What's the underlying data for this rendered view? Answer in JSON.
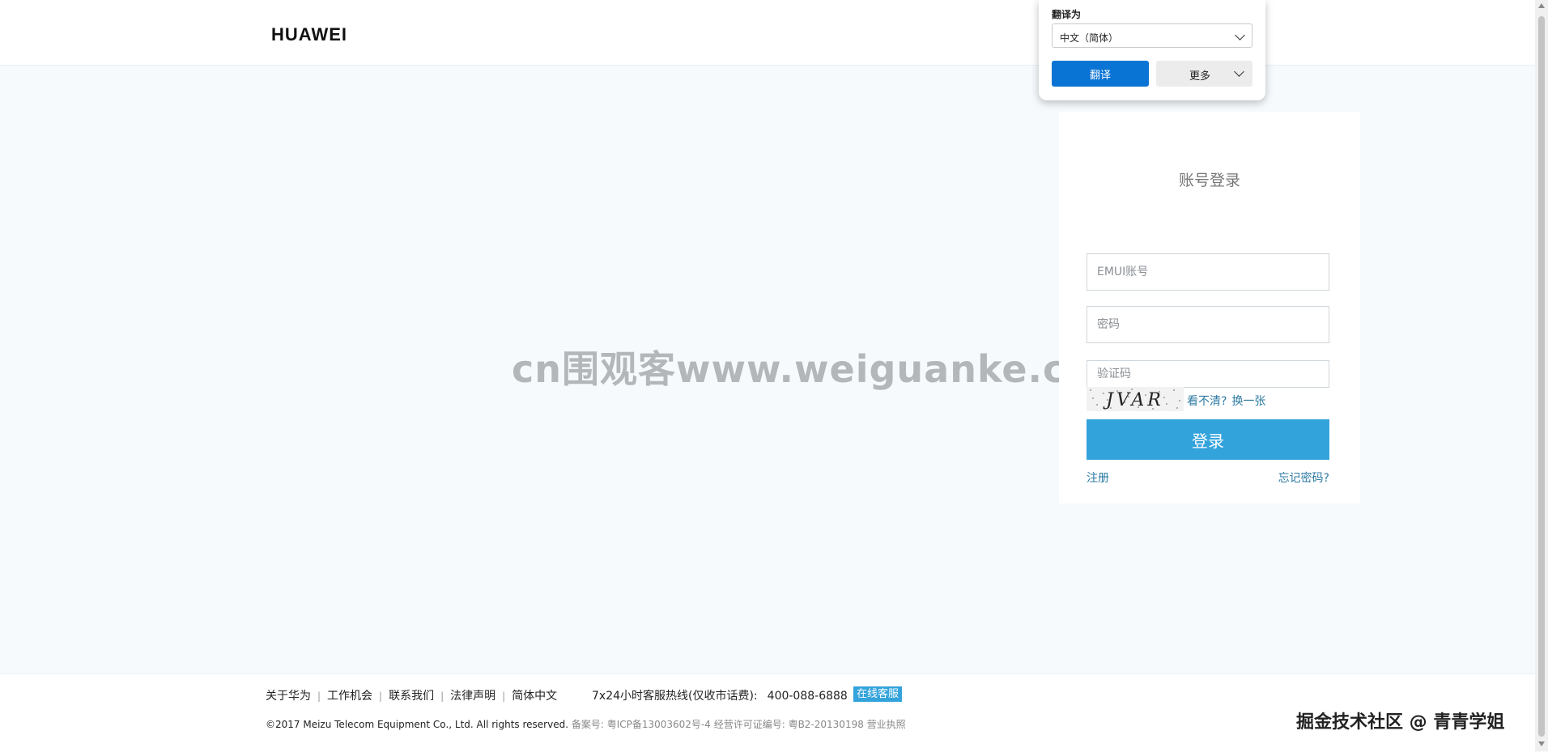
{
  "header": {
    "logo": "HUAWEI"
  },
  "watermark": "cn围观客www.weiguanke.cn",
  "translate_popup": {
    "label": "翻译为",
    "selected_language": "中文（简体）",
    "translate_button": "翻译",
    "more_button": "更多"
  },
  "login": {
    "title": "账号登录",
    "account_placeholder": "EMUI账号",
    "password_placeholder": "密码",
    "captcha_placeholder": "验证码",
    "captcha_image_text": "JVAR",
    "captcha_unclear": "看不清?",
    "captcha_refresh": "换一张",
    "submit": "登录",
    "register": "注册",
    "forgot": "忘记密码?"
  },
  "footer": {
    "links": [
      "关于华为",
      "工作机会",
      "联系我们",
      "法律声明",
      "简体中文"
    ],
    "hotline_label": "7x24小时客服热线(仅收市话费):",
    "hotline_number": "400-088-6888",
    "online_service": "在线客服",
    "copyright": "©2017 Meizu Telecom Equipment Co., Ltd. All rights reserved.",
    "beian": "备案号: 粤ICP备13003602号-4 经营许可证编号: 粤B2-20130198 营业执照"
  },
  "juejin_watermark": "掘金技术社区 @ 青青学姐"
}
